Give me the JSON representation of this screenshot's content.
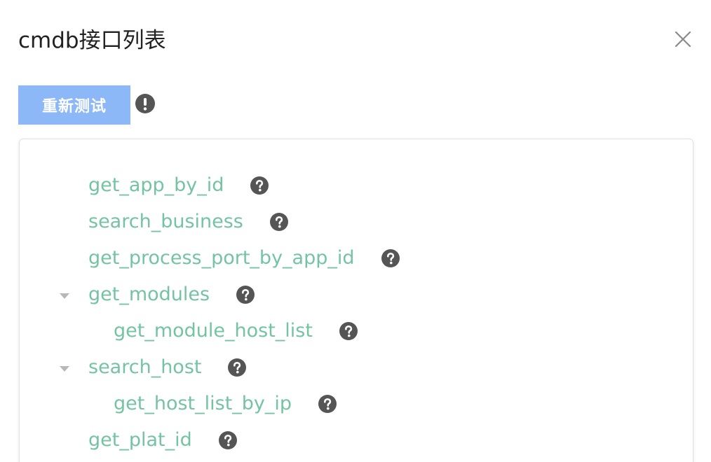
{
  "dialog": {
    "title": "cmdb接口列表",
    "retest_label": "重新测试"
  },
  "icons": {
    "close": "close-icon",
    "warning": "exclamation-circle-icon",
    "help": "question-circle-icon",
    "caret": "caret-down-icon"
  },
  "colors": {
    "accent_button": "#8db8f7",
    "tree_text": "#74c4a3",
    "icon_dark": "#555555",
    "caret": "#b8b8b8"
  },
  "tree": {
    "items": [
      {
        "label": "get_app_by_id",
        "level": 0,
        "expanded": null
      },
      {
        "label": "search_business",
        "level": 0,
        "expanded": null
      },
      {
        "label": "get_process_port_by_app_id",
        "level": 0,
        "expanded": null
      },
      {
        "label": "get_modules",
        "level": 0,
        "expanded": true
      },
      {
        "label": "get_module_host_list",
        "level": 1,
        "expanded": null
      },
      {
        "label": "search_host",
        "level": 0,
        "expanded": true
      },
      {
        "label": "get_host_list_by_ip",
        "level": 1,
        "expanded": null
      },
      {
        "label": "get_plat_id",
        "level": 0,
        "expanded": null
      }
    ]
  }
}
